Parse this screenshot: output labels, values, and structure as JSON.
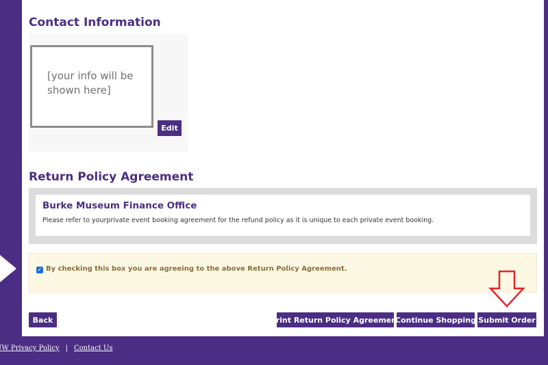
{
  "contact": {
    "title": "Contact Information",
    "placeholder": "[your info will be shown here]",
    "edit_label": "Edit"
  },
  "return_policy": {
    "title": "Return Policy Agreement",
    "org_name": "Burke Museum Finance Office",
    "text": "Please refer to yourprivate event booking agreement for the refund policy as it is unique to each private event booking."
  },
  "agreement": {
    "checked": true,
    "label": "By checking this box you are agreeing to the above Return Policy Agreement."
  },
  "actions": {
    "back": "Back",
    "print_policy": "Print Return Policy Agreement",
    "continue_shopping": "Continue Shopping",
    "submit_order": "Submit Order"
  },
  "footer": {
    "privacy": "UW Privacy Policy",
    "separator": "|",
    "contact": "Contact Us"
  },
  "colors": {
    "brand": "#4b2e83",
    "alert_bg": "#fcf8e3",
    "annotation_red": "#e8212a"
  }
}
